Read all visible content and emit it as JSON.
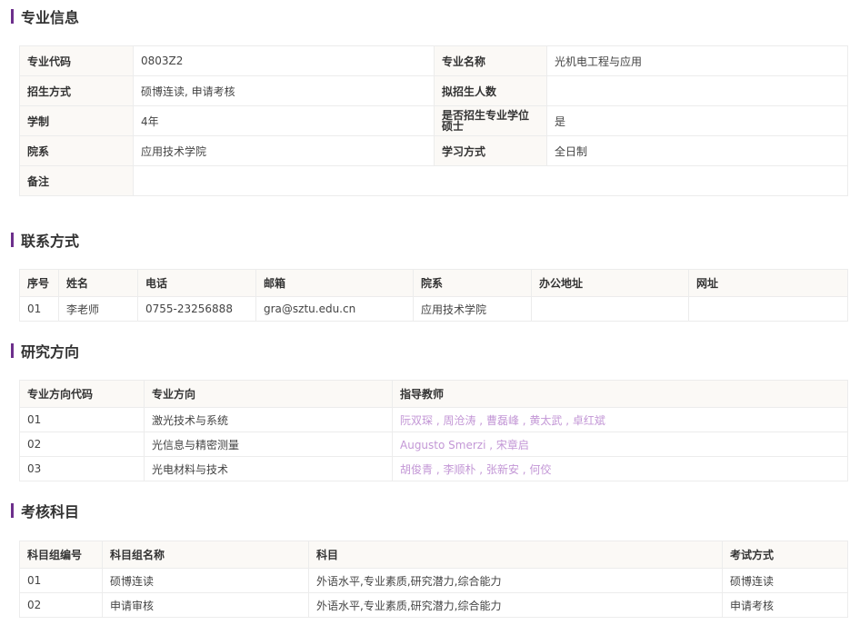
{
  "sections": {
    "major_info": "专业信息",
    "contact": "联系方式",
    "research": "研究方向",
    "exam": "考核科目"
  },
  "major_info": {
    "rows": [
      {
        "l1": "专业代码",
        "v1": "0803Z2",
        "l2": "专业名称",
        "v2": "光机电工程与应用"
      },
      {
        "l1": "招生方式",
        "v1": "硕博连读, 申请考核",
        "l2": "拟招生人数",
        "v2": ""
      },
      {
        "l1": "学制",
        "v1": "4年",
        "l2": "是否招生专业学位硕士",
        "v2": "是"
      },
      {
        "l1": "院系",
        "v1": "应用技术学院",
        "l2": "学习方式",
        "v2": "全日制"
      }
    ],
    "remark_label": "备注",
    "remark_value": ""
  },
  "contact": {
    "headers": [
      "序号",
      "姓名",
      "电话",
      "邮箱",
      "院系",
      "办公地址",
      "网址"
    ],
    "rows": [
      [
        "01",
        "李老师",
        "0755-23256888",
        "gra@sztu.edu.cn",
        "应用技术学院",
        "",
        ""
      ]
    ]
  },
  "research": {
    "headers": [
      "专业方向代码",
      "专业方向",
      "指导教师"
    ],
    "rows": [
      {
        "code": "01",
        "direction": "激光技术与系统",
        "teachers": [
          "阮双琛",
          "周沧涛",
          "曹磊峰",
          "黄太武",
          "卓红斌"
        ]
      },
      {
        "code": "02",
        "direction": "光信息与精密测量",
        "teachers": [
          "Augusto Smerzi",
          "宋章启"
        ]
      },
      {
        "code": "03",
        "direction": "光电材料与技术",
        "teachers": [
          "胡俊青",
          "李顺朴",
          "张新安",
          "何佼"
        ]
      }
    ],
    "separator": " , "
  },
  "exam": {
    "headers": [
      "科目组编号",
      "科目组名称",
      "科目",
      "考试方式"
    ],
    "rows": [
      [
        "01",
        "硕博连读",
        "外语水平,专业素质,研究潜力,综合能力",
        "硕博连读"
      ],
      [
        "02",
        "申请审核",
        "外语水平,专业素质,研究潜力,综合能力",
        "申请考核"
      ]
    ]
  }
}
